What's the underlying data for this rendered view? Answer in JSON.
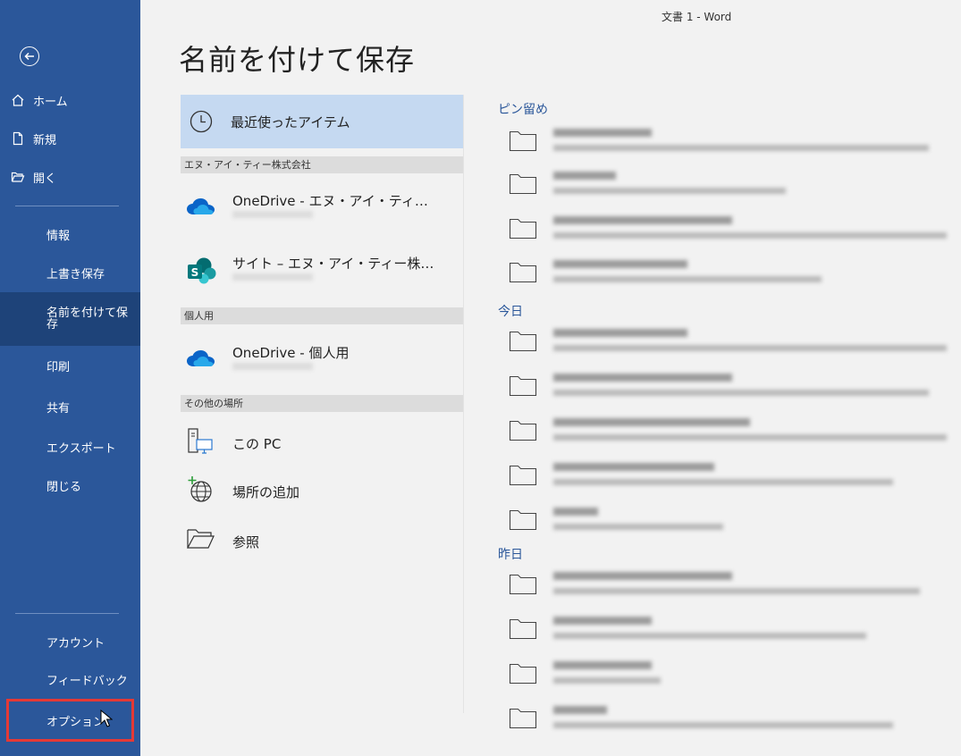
{
  "window": {
    "title": "文書 1 - Word"
  },
  "sidebar": {
    "top_items": [
      {
        "label": "ホーム"
      },
      {
        "label": "新規"
      },
      {
        "label": "開く"
      }
    ],
    "items": [
      {
        "label": "情報"
      },
      {
        "label": "上書き保存"
      },
      {
        "label": "名前を付けて保存"
      },
      {
        "label": "印刷"
      },
      {
        "label": "共有"
      },
      {
        "label": "エクスポート"
      },
      {
        "label": "閉じる"
      }
    ],
    "bottom_items": [
      {
        "label": "アカウント"
      },
      {
        "label": "フィードバック"
      },
      {
        "label": "オプション"
      }
    ]
  },
  "main": {
    "title": "名前を付けて保存",
    "recent_label": "最近使ったアイテム",
    "sections": [
      {
        "header": "エヌ・アイ・ティー株式会社"
      },
      {
        "header": "個人用"
      },
      {
        "header": "その他の場所"
      }
    ],
    "locations": {
      "onedrive_org": "OneDrive - エヌ・アイ・ティ…",
      "sharepoint": "サイト – エヌ・アイ・ティー株…",
      "onedrive_personal": "OneDrive - 個人用",
      "this_pc": "この PC",
      "add_place": "場所の追加",
      "browse": "参照"
    }
  },
  "recent": {
    "groups": [
      {
        "label": "ピン留め"
      },
      {
        "label": "今日"
      },
      {
        "label": "昨日"
      }
    ]
  },
  "colors": {
    "sidebar": "#2b579a",
    "sidebar_active": "#1e4379",
    "accent": "#2b579a",
    "highlight_box": "#e53935",
    "recent_selected": "#c5d9f1"
  }
}
